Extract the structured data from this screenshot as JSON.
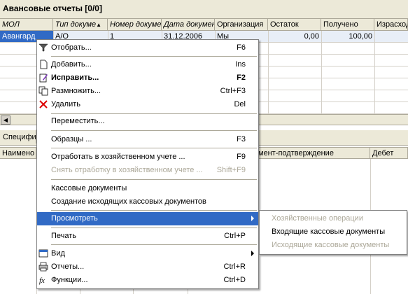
{
  "window": {
    "title": "Авансовые отчеты [0/0]"
  },
  "grid": {
    "columns": [
      "МОЛ",
      "Тип докуме",
      "Номер докуме",
      "Дата докумен",
      "Организация",
      "Остаток",
      "Получено",
      "Израсход"
    ],
    "rows": [
      [
        "Авангард",
        "А/О",
        "1",
        "31.12.2006",
        "Мы",
        "0,00",
        "100,00",
        ""
      ]
    ]
  },
  "spec": {
    "tab_label": "Специфи",
    "columns": [
      "Наимено",
      "мент-подтверждение",
      "Дебет"
    ]
  },
  "menu": {
    "items": [
      {
        "label": "Отобрать...",
        "shortcut": "F6",
        "icon": "filter-icon"
      },
      {
        "label": "Добавить...",
        "shortcut": "Ins",
        "icon": "new-document-icon"
      },
      {
        "label": "Исправить...",
        "shortcut": "F2",
        "icon": "edit-document-icon"
      },
      {
        "label": "Размножить...",
        "shortcut": "Ctrl+F3",
        "icon": "copy-document-icon"
      },
      {
        "label": "Удалить",
        "shortcut": "Del",
        "icon": "delete-icon"
      },
      {
        "label": "Переместить...",
        "shortcut": ""
      },
      {
        "label": "Образцы ...",
        "shortcut": "F3"
      },
      {
        "label": "Отработать в хозяйственном учете ...",
        "shortcut": "F9"
      },
      {
        "label": "Снять отработку в хозяйственном учете ...",
        "shortcut": "Shift+F9"
      },
      {
        "label": "Кассовые документы",
        "shortcut": ""
      },
      {
        "label": "Создание исходящих кассовых документов",
        "shortcut": ""
      },
      {
        "label": "Просмотреть",
        "shortcut": ""
      },
      {
        "label": "Печать",
        "shortcut": "Ctrl+P"
      },
      {
        "label": "Вид",
        "shortcut": "",
        "icon": "view-icon"
      },
      {
        "label": "Отчеты...",
        "shortcut": "Ctrl+R",
        "icon": "printer-icon"
      },
      {
        "label": "Функции...",
        "shortcut": "Ctrl+D",
        "icon": "function-icon"
      }
    ]
  },
  "submenu": {
    "items": [
      {
        "label": "Хозяйственные операции"
      },
      {
        "label": "Входящие кассовые документы"
      },
      {
        "label": "Исходящие кассовые документы"
      }
    ]
  },
  "colors": {
    "selection": "#316ac5",
    "chrome": "#ece9d8",
    "disabled_text": "#aca899"
  }
}
